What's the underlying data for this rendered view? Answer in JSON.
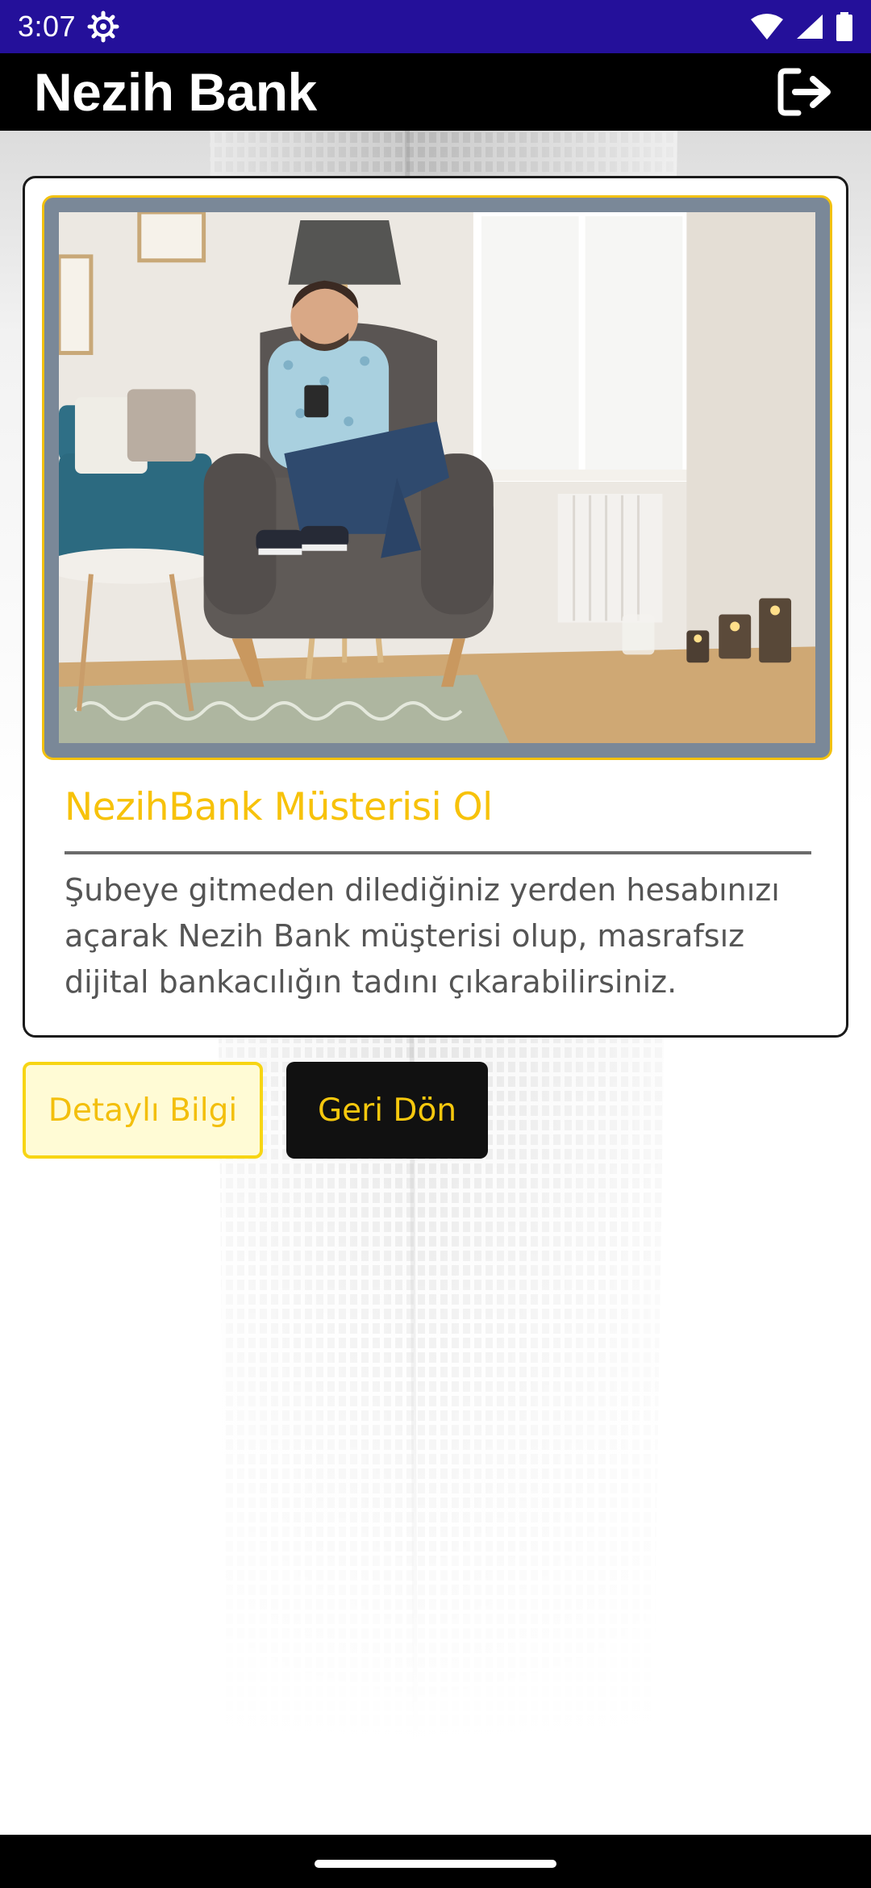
{
  "status_bar": {
    "time": "3:07",
    "icons": [
      "settings-icon",
      "wifi-icon",
      "signal-icon",
      "battery-icon"
    ]
  },
  "app_bar": {
    "title": "Nezih Bank",
    "logout_icon": "logout-icon"
  },
  "card": {
    "image": "man-in-armchair-with-phone-photo",
    "title": "NezihBank Müsterisi Ol",
    "description": "Şubeye gitmeden dilediğiniz yerden hesabınızı açarak Nezih Bank müşterisi olup, masrafsız dijital bankacılığın tadını çıkarabilirsiniz."
  },
  "buttons": {
    "detail_label": "Detaylı Bilgi",
    "back_label": "Geri Dön"
  },
  "colors": {
    "status_bar": "#24109a",
    "app_bar": "#000000",
    "accent_yellow": "#f7c20a",
    "button_dark": "#111111"
  }
}
